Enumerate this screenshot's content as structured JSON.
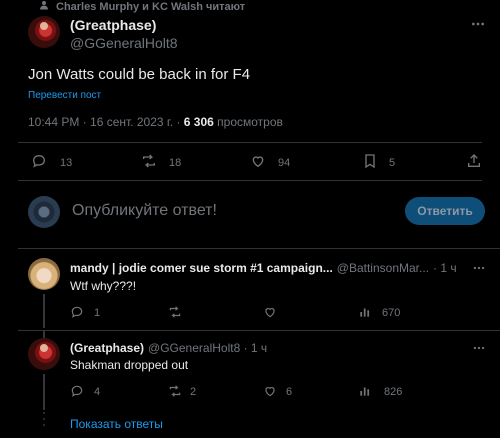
{
  "social_context": "Charles Murphy и KC Walsh читают",
  "main_post": {
    "display_name": "(Greatphase)",
    "handle": "@GGeneralHolt8",
    "text": "Jon Watts could be back in for F4",
    "translate_label": "Перевести пост",
    "timestamp": "10:44 PM · 16 сент. 2023 г. ·",
    "views_count": "6 306",
    "views_label": "просмотров",
    "stats": {
      "replies": "13",
      "reposts": "18",
      "likes": "94",
      "bookmarks": "5"
    }
  },
  "composer": {
    "placeholder": "Опубликуйте ответ!",
    "reply_button": "Ответить"
  },
  "replies": [
    {
      "display_name": "mandy | jodie comer sue storm #1 campaign...",
      "handle": "@BattinsonMar...",
      "time": "· 1 ч",
      "text": "Wtf why???!",
      "stats": {
        "replies": "1",
        "reposts": "",
        "likes": "",
        "views": "670"
      }
    },
    {
      "display_name": "(Greatphase)",
      "handle": "@GGeneralHolt8 · 1 ч",
      "text": "Shakman dropped out",
      "stats": {
        "replies": "4",
        "reposts": "2",
        "likes": "6",
        "views": "826"
      }
    }
  ],
  "show_replies": "Показать ответы",
  "icons": [
    "person-icon",
    "more-icon",
    "reply-icon",
    "repost-icon",
    "like-icon",
    "bookmark-icon",
    "share-icon",
    "views-icon"
  ],
  "colors": {
    "background": "#000000",
    "accent": "#1d9bf0",
    "muted": "#71767b",
    "text": "#e7e9ea"
  }
}
